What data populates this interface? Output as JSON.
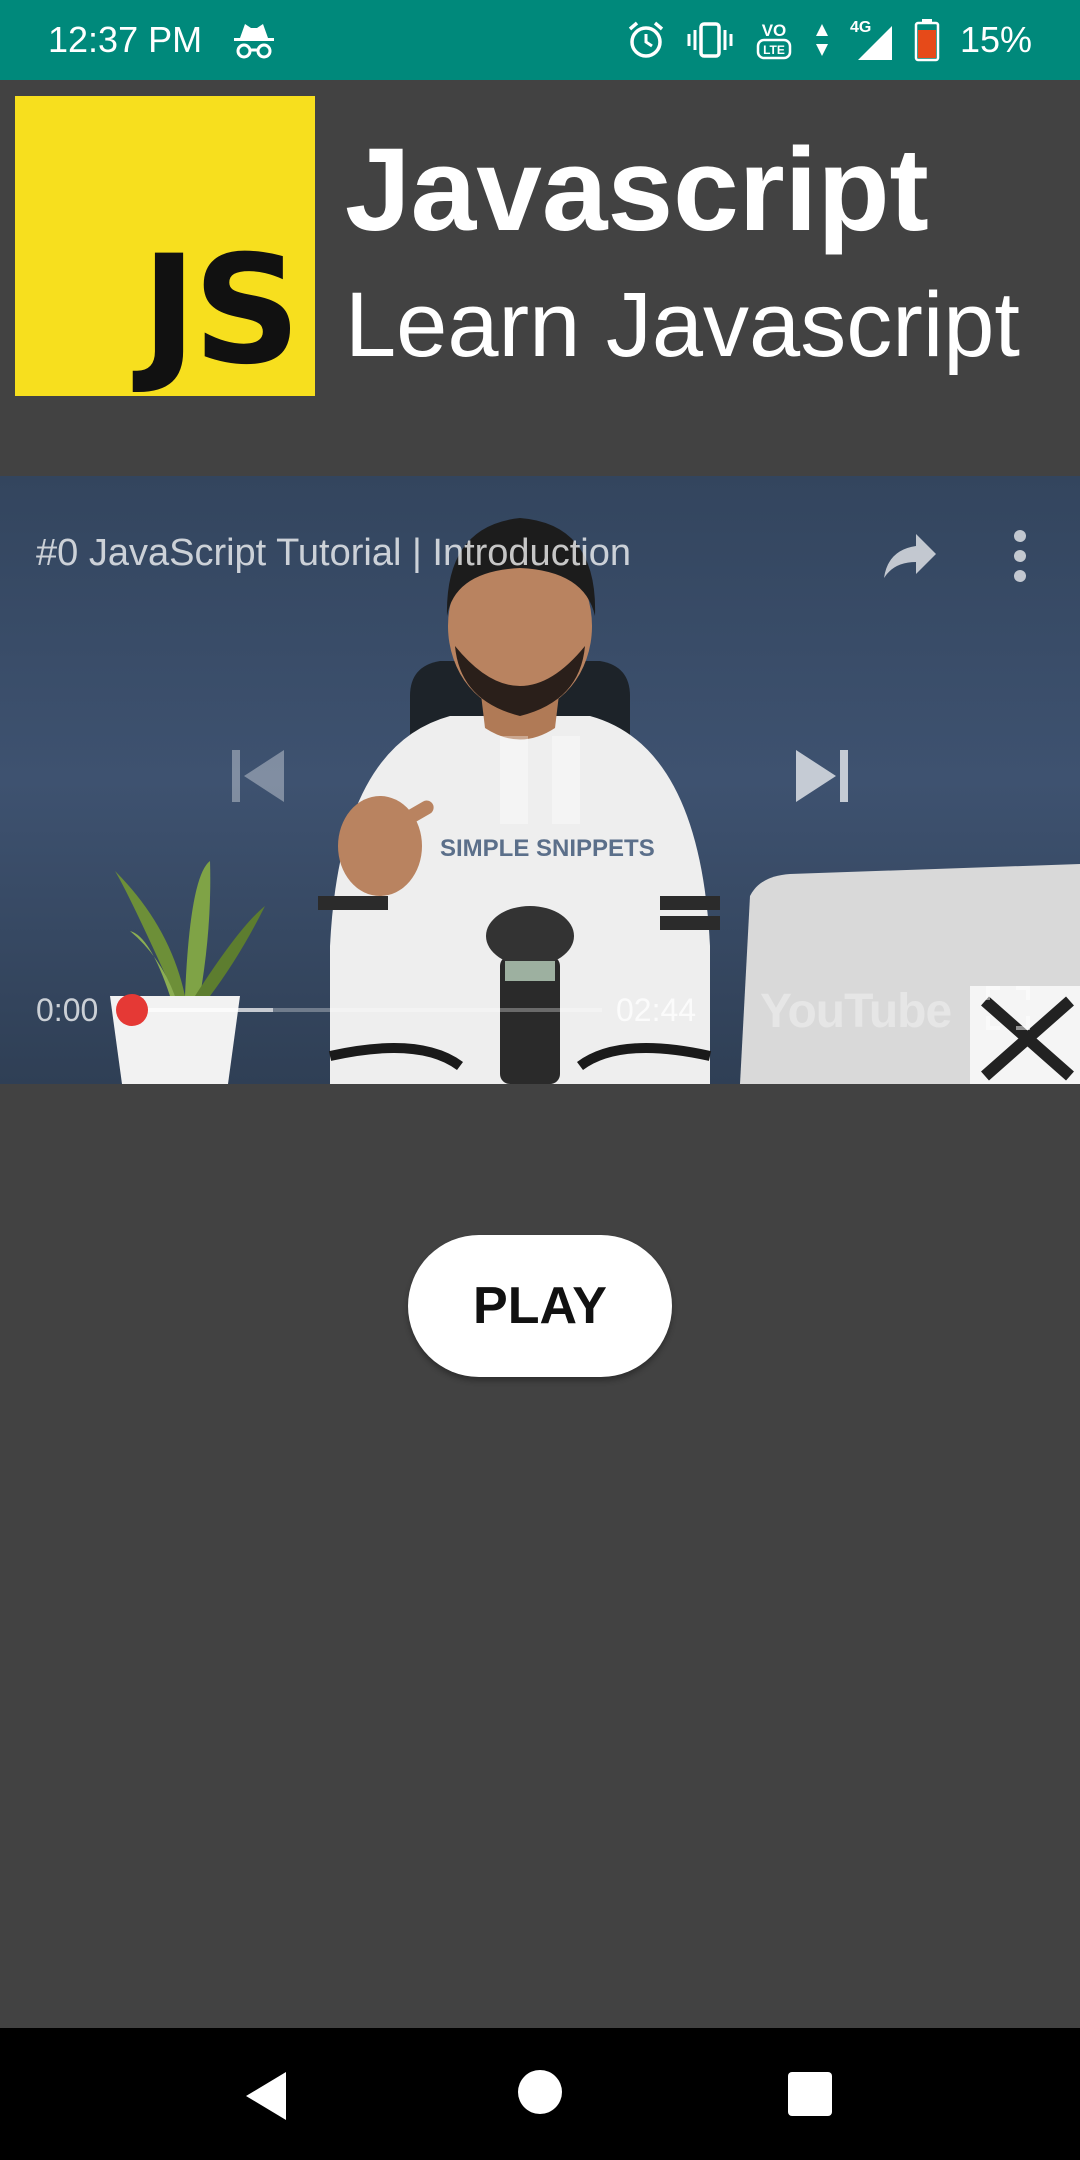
{
  "status_bar": {
    "time": "12:37 PM",
    "battery_percent": "15%",
    "network_label": "4G",
    "volte_label": "VoLTE",
    "icons": [
      "incognito-icon",
      "alarm-icon",
      "vibrate-icon",
      "volte-icon",
      "data-arrows-icon",
      "signal-icon",
      "battery-icon"
    ],
    "battery_level": 0.15,
    "battery_color": "#e64a19"
  },
  "header": {
    "logo_text": "JS",
    "title": "Javascript",
    "subtitle": "Learn Javascript"
  },
  "video": {
    "title": "#0 JavaScript Tutorial | Introduction",
    "current_time": "0:00",
    "duration": "02:44",
    "watermark": "YouTube",
    "progress": 0.0,
    "buffered": 0.3
  },
  "play_button_label": "PLAY",
  "nav_bar": {
    "icons": [
      "back-icon",
      "home-icon",
      "recents-icon"
    ]
  },
  "colors": {
    "status_bar": "#00897b",
    "background": "#424242",
    "logo_yellow": "#f7df1e",
    "progress_thumb": "#e53935"
  }
}
